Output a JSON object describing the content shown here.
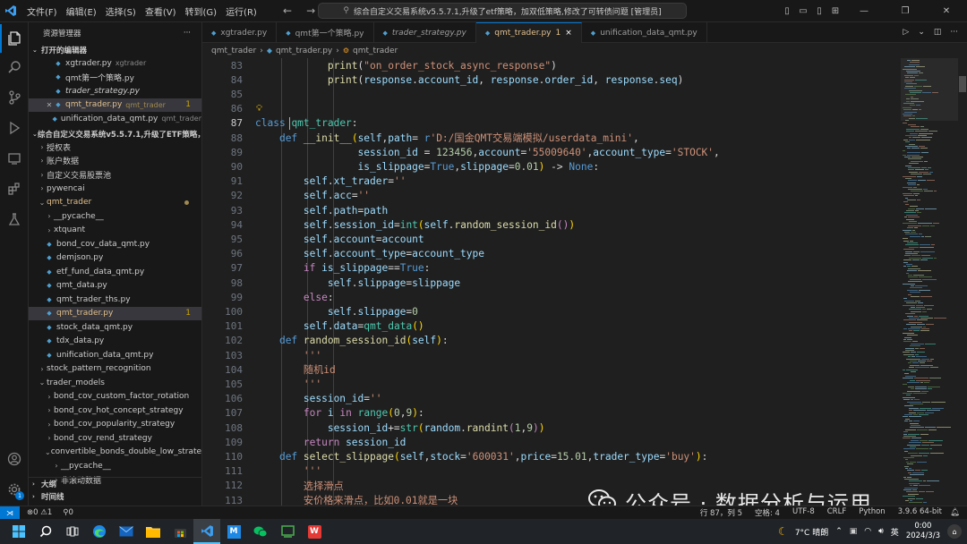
{
  "titlebar": {
    "menu": [
      "文件(F)",
      "编辑(E)",
      "选择(S)",
      "查看(V)",
      "转到(G)",
      "运行(R)"
    ],
    "command_center": "综合自定义交易系统v5.5.7.1,升级了etf策略，加双低策略,修改了可转债问题 [管理员]"
  },
  "sidebar": {
    "header": "资源管理器",
    "open_editors_title": "打开的编辑器",
    "open_editors": [
      {
        "name": "xgtrader.py",
        "desc": "xgtrader",
        "italic": false
      },
      {
        "name": "qmt第一个策略.py",
        "desc": "",
        "italic": false
      },
      {
        "name": "trader_strategy.py",
        "desc": "",
        "italic": true
      },
      {
        "name": "qmt_trader.py",
        "desc": "qmt_trader",
        "badge": "1",
        "italic": false
      },
      {
        "name": "unification_data_qmt.py",
        "desc": "qmt_trader",
        "italic": false
      }
    ],
    "workspace_title": "综合自定义交易系统v5.5.7.1,升级了ETF策略，加...",
    "tree": [
      {
        "label": "授权表",
        "indent": 0,
        "type": "folder"
      },
      {
        "label": "账户数据",
        "indent": 0,
        "type": "folder"
      },
      {
        "label": "自定义交易股票池",
        "indent": 0,
        "type": "folder"
      },
      {
        "label": "pywencai",
        "indent": 0,
        "type": "folder"
      },
      {
        "label": "qmt_trader",
        "indent": 0,
        "type": "folder-open",
        "mod": true
      },
      {
        "label": "__pycache__",
        "indent": 1,
        "type": "folder"
      },
      {
        "label": "xtquant",
        "indent": 1,
        "type": "folder"
      },
      {
        "label": "bond_cov_data_qmt.py",
        "indent": 1,
        "type": "py"
      },
      {
        "label": "demjson.py",
        "indent": 1,
        "type": "py"
      },
      {
        "label": "etf_fund_data_qmt.py",
        "indent": 1,
        "type": "py"
      },
      {
        "label": "qmt_data.py",
        "indent": 1,
        "type": "py"
      },
      {
        "label": "qmt_trader_ths.py",
        "indent": 1,
        "type": "py"
      },
      {
        "label": "qmt_trader.py",
        "indent": 1,
        "type": "py",
        "badge": "1",
        "mod": true,
        "active": true
      },
      {
        "label": "stock_data_qmt.py",
        "indent": 1,
        "type": "py"
      },
      {
        "label": "tdx_data.py",
        "indent": 1,
        "type": "py"
      },
      {
        "label": "unification_data_qmt.py",
        "indent": 1,
        "type": "py"
      },
      {
        "label": "stock_pattern_recognition",
        "indent": 0,
        "type": "folder"
      },
      {
        "label": "trader_models",
        "indent": 0,
        "type": "folder-open"
      },
      {
        "label": "bond_cov_custom_factor_rotation",
        "indent": 1,
        "type": "folder"
      },
      {
        "label": "bond_cov_hot_concept_strategy",
        "indent": 1,
        "type": "folder"
      },
      {
        "label": "bond_cov_popularity_strategy",
        "indent": 1,
        "type": "folder"
      },
      {
        "label": "bond_cov_rend_strategy",
        "indent": 1,
        "type": "folder"
      },
      {
        "label": "convertible_bonds_double_low_strategy",
        "indent": 1,
        "type": "folder-open"
      },
      {
        "label": "__pycache__",
        "indent": 2,
        "type": "folder"
      },
      {
        "label": "非滚动数据",
        "indent": 2,
        "type": "folder"
      }
    ],
    "outline": "大纲",
    "timeline": "时间线"
  },
  "tabs": [
    {
      "label": "xgtrader.py",
      "italic": false,
      "active": false
    },
    {
      "label": "qmt第一个策略.py",
      "italic": false,
      "active": false
    },
    {
      "label": "trader_strategy.py",
      "italic": true,
      "active": false
    },
    {
      "label": "qmt_trader.py",
      "italic": false,
      "active": true,
      "badge": "1",
      "close": "×"
    },
    {
      "label": "unification_data_qmt.py",
      "italic": false,
      "active": false
    }
  ],
  "breadcrumb": {
    "folder": "qmt_trader",
    "file": "qmt_trader.py",
    "symbol": "qmt_trader"
  },
  "editor": {
    "current_line": 87,
    "lines": [
      {
        "n": 83,
        "html": "            <span class='f'>print</span><span class='p'>(</span><span class='s'>\"on_order_stock_async_response\"</span><span class='p'>)</span>"
      },
      {
        "n": 84,
        "html": "            <span class='f'>print</span><span class='p'>(</span><span class='v'>response</span><span class='p'>.</span><span class='v'>account_id</span><span class='p'>, </span><span class='v'>response</span><span class='p'>.</span><span class='v'>order_id</span><span class='p'>, </span><span class='v'>response</span><span class='p'>.</span><span class='v'>seq</span><span class='p'>)</span>"
      },
      {
        "n": 85,
        "html": ""
      },
      {
        "n": 86,
        "html": ""
      },
      {
        "n": 87,
        "html": "<span class='k'>class</span> <span class='c'>qmt_trader</span><span class='p'>:</span>"
      },
      {
        "n": 88,
        "html": "    <span class='k'>def</span> <span class='f'>__init__</span><span class='y'>(</span><span class='v'>self</span><span class='p'>,</span><span class='v'>path</span><span class='p'>= </span><span class='k'>r</span><span class='s'>'D:/国金QMT交易端模拟/userdata_mini'</span><span class='p'>,</span>"
      },
      {
        "n": 89,
        "html": "                 <span class='v'>session_id</span> <span class='p'>= </span><span class='n'>123456</span><span class='p'>,</span><span class='v'>account</span><span class='p'>=</span><span class='s'>'55009640'</span><span class='p'>,</span><span class='v'>account_type</span><span class='p'>=</span><span class='s'>'STOCK'</span><span class='p'>,</span>"
      },
      {
        "n": 90,
        "html": "                 <span class='v'>is_slippage</span><span class='p'>=</span><span class='k'>True</span><span class='p'>,</span><span class='v'>slippage</span><span class='p'>=</span><span class='n'>0.01</span><span class='y'>)</span> <span class='p'>-> </span><span class='k'>None</span><span class='p'>:</span>"
      },
      {
        "n": 91,
        "html": "        <span class='v'>self</span><span class='p'>.</span><span class='v'>xt_trader</span><span class='p'>=</span><span class='s'>''</span>"
      },
      {
        "n": 92,
        "html": "        <span class='v'>self</span><span class='p'>.</span><span class='v'>acc</span><span class='p'>=</span><span class='s'>''</span>"
      },
      {
        "n": 93,
        "html": "        <span class='v'>self</span><span class='p'>.</span><span class='v'>path</span><span class='p'>=</span><span class='v'>path</span>"
      },
      {
        "n": 94,
        "html": "        <span class='v'>self</span><span class='p'>.</span><span class='v'>session_id</span><span class='p'>=</span><span class='c'>int</span><span class='y'>(</span><span class='v'>self</span><span class='p'>.</span><span class='f'>random_session_id</span><span class='kw'>()</span><span class='y'>)</span>"
      },
      {
        "n": 95,
        "html": "        <span class='v'>self</span><span class='p'>.</span><span class='v'>account</span><span class='p'>=</span><span class='v'>account</span>"
      },
      {
        "n": 96,
        "html": "        <span class='v'>self</span><span class='p'>.</span><span class='v'>account_type</span><span class='p'>=</span><span class='v'>account_type</span>"
      },
      {
        "n": 97,
        "html": "        <span class='kw'>if</span> <span class='v'>is_slippage</span><span class='p'>==</span><span class='k'>True</span><span class='p'>:</span>"
      },
      {
        "n": 98,
        "html": "            <span class='v'>self</span><span class='p'>.</span><span class='v'>slippage</span><span class='p'>=</span><span class='v'>slippage</span>"
      },
      {
        "n": 99,
        "html": "        <span class='kw'>else</span><span class='p'>:</span>"
      },
      {
        "n": 100,
        "html": "            <span class='v'>self</span><span class='p'>.</span><span class='v'>slippage</span><span class='p'>=</span><span class='n'>0</span>"
      },
      {
        "n": 101,
        "html": "        <span class='v'>self</span><span class='p'>.</span><span class='v'>data</span><span class='p'>=</span><span class='c'>qmt_data</span><span class='y'>()</span>"
      },
      {
        "n": 102,
        "html": "    <span class='k'>def</span> <span class='f'>random_session_id</span><span class='y'>(</span><span class='v'>self</span><span class='y'>)</span><span class='p'>:</span>"
      },
      {
        "n": 103,
        "html": "        <span class='cm'>'''</span>"
      },
      {
        "n": 104,
        "html": "        <span class='cm'>随机id</span>"
      },
      {
        "n": 105,
        "html": "        <span class='cm'>'''</span>"
      },
      {
        "n": 106,
        "html": "        <span class='v'>session_id</span><span class='p'>=</span><span class='s'>''</span>"
      },
      {
        "n": 107,
        "html": "        <span class='kw'>for</span> <span class='v'>i</span> <span class='kw'>in</span> <span class='c'>range</span><span class='y'>(</span><span class='n'>0</span><span class='p'>,</span><span class='n'>9</span><span class='y'>)</span><span class='p'>:</span>"
      },
      {
        "n": 108,
        "html": "            <span class='v'>session_id</span><span class='p'>+=</span><span class='c'>str</span><span class='y'>(</span><span class='v'>random</span><span class='p'>.</span><span class='f'>randint</span><span class='kw'>(</span><span class='n'>1</span><span class='p'>,</span><span class='n'>9</span><span class='kw'>)</span><span class='y'>)</span>"
      },
      {
        "n": 109,
        "html": "        <span class='kw'>return</span> <span class='v'>session_id</span>"
      },
      {
        "n": 110,
        "html": "    <span class='k'>def</span> <span class='f'>select_slippage</span><span class='y'>(</span><span class='v'>self</span><span class='p'>,</span><span class='v'>stock</span><span class='p'>=</span><span class='s'>'600031'</span><span class='p'>,</span><span class='v'>price</span><span class='p'>=</span><span class='n'>15.01</span><span class='p'>,</span><span class='v'>trader_type</span><span class='p'>=</span><span class='s'>'buy'</span><span class='y'>)</span><span class='p'>:</span>"
      },
      {
        "n": 111,
        "html": "        <span class='cm'>'''</span>"
      },
      {
        "n": 112,
        "html": "        <span class='cm'>选择滑点</span>"
      },
      {
        "n": 113,
        "html": "        <span class='cm'>安价格来滑点，比如0.01就是一块</span>"
      }
    ]
  },
  "statusbar": {
    "problems": "⊗0 ⚠1",
    "ports": "⚲0",
    "position": "行 87，列 5",
    "spaces": "空格: 4",
    "encoding": "UTF-8",
    "eol": "CRLF",
    "language": "Python",
    "interpreter": "3.9.6 64-bit"
  },
  "watermark": {
    "text": "公众号 · 数据分析与运用"
  },
  "taskbar": {
    "weather": "7°C 晴朗",
    "lang": "英",
    "time": "0:00",
    "date": "2024/3/3"
  }
}
